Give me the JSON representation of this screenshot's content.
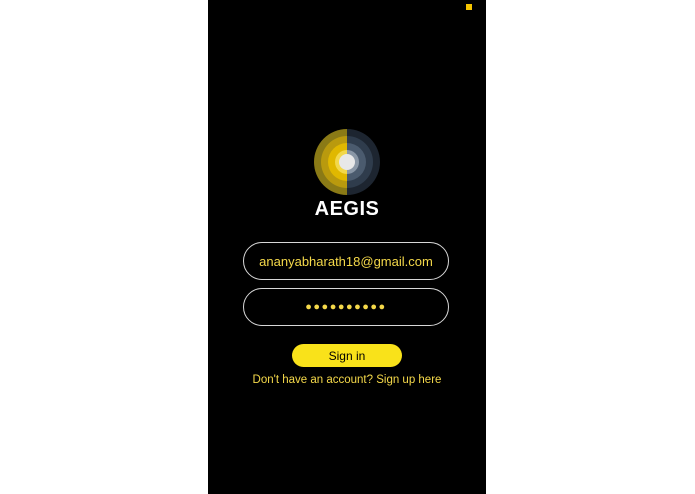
{
  "app": {
    "title": "AEGIS",
    "accent_color": "#f9e21a",
    "background_color": "#000000"
  },
  "status_bar": {
    "indicator_icon": "square-indicator-icon"
  },
  "logo": {
    "icon": "concentric-circles-logo-icon"
  },
  "login_form": {
    "email_value": "ananyabharath18@gmail.com",
    "password_value": "●●●●●●●●●●",
    "sign_in_label": "Sign in",
    "signup_prompt": "Don't have an account? Sign up here"
  }
}
